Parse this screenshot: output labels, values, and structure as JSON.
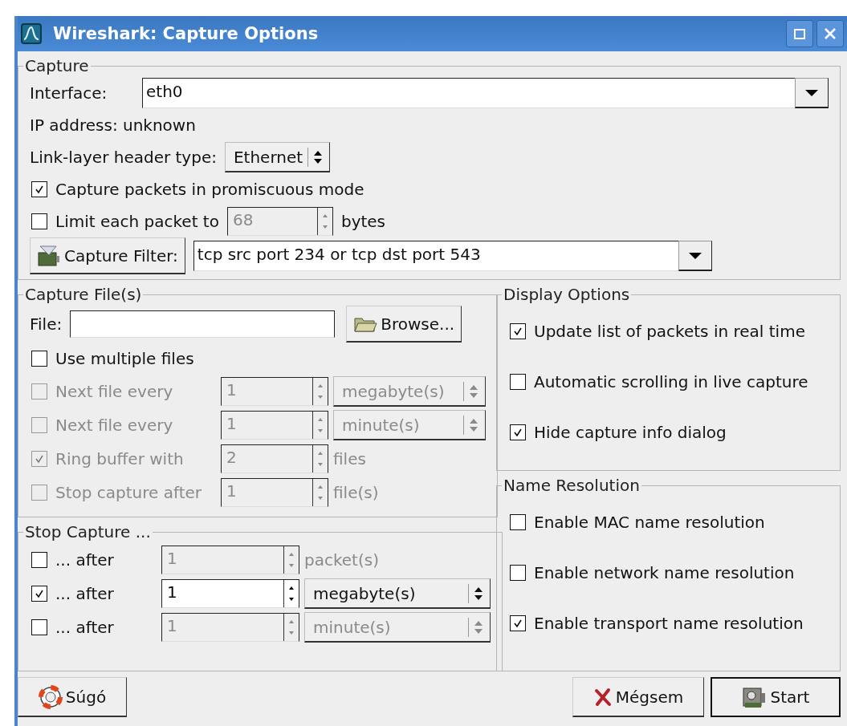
{
  "window": {
    "title": "Wireshark: Capture Options"
  },
  "capture": {
    "title": "Capture",
    "interface_label": "Interface:",
    "interface": "eth0",
    "ip_address": "IP address: unknown",
    "link_layer_label": "Link-layer header type:",
    "link_layer": "Ethernet",
    "promiscuous": {
      "label": "Capture packets in promiscuous mode",
      "checked": true
    },
    "limit": {
      "label": "Limit each packet to",
      "checked": false,
      "value": "68",
      "unit": "bytes"
    },
    "filter_button": "Capture Filter:",
    "filter": "tcp src port 234 or tcp dst port 543"
  },
  "capture_files": {
    "title": "Capture File(s)",
    "file_label": "File:",
    "browse_button": "Browse...",
    "multiple": {
      "label": "Use multiple files",
      "checked": false
    },
    "rows": [
      {
        "label": "Next file every",
        "checked": false,
        "disabled": true,
        "value": "1",
        "kind": "dropdown",
        "unit": "megabyte(s)"
      },
      {
        "label": "Next file every",
        "checked": false,
        "disabled": true,
        "value": "1",
        "kind": "dropdown",
        "unit": "minute(s)"
      },
      {
        "label": "Ring buffer with",
        "checked": true,
        "disabled": true,
        "value": "2",
        "kind": "text",
        "unit": "files"
      },
      {
        "label": "Stop capture after",
        "checked": false,
        "disabled": true,
        "value": "1",
        "kind": "text",
        "unit": "file(s)"
      }
    ]
  },
  "stop_capture": {
    "title": "Stop Capture ...",
    "rows": [
      {
        "label": "... after",
        "checked": false,
        "value": "1",
        "kind": "text",
        "unit": "packet(s)"
      },
      {
        "label": "... after",
        "checked": true,
        "value": "1",
        "kind": "dropdown",
        "unit": "megabyte(s)"
      },
      {
        "label": "... after",
        "checked": false,
        "value": "1",
        "kind": "dropdown",
        "unit": "minute(s)"
      }
    ]
  },
  "display_options": {
    "title": "Display Options",
    "items": [
      {
        "label": "Update list of packets in real time",
        "checked": true
      },
      {
        "label": "Automatic scrolling in live capture",
        "checked": false
      },
      {
        "label": "Hide capture info dialog",
        "checked": true
      }
    ]
  },
  "name_resolution": {
    "title": "Name Resolution",
    "items": [
      {
        "label": "Enable MAC name resolution",
        "checked": false
      },
      {
        "label": "Enable network name resolution",
        "checked": false
      },
      {
        "label": "Enable transport name resolution",
        "checked": true
      }
    ]
  },
  "buttons": {
    "help": "Súgó",
    "cancel": "Mégsem",
    "start": "Start"
  }
}
